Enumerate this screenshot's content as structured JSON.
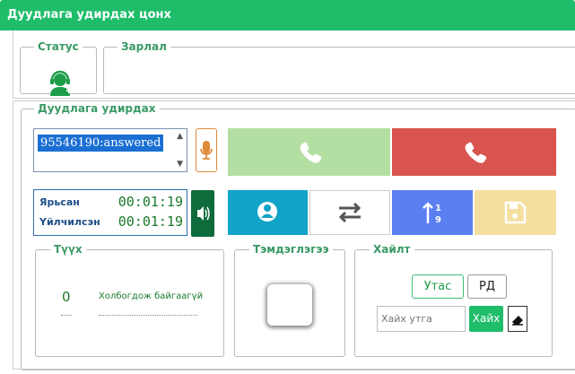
{
  "header": {
    "title": "Дуудлага удирдах цонх"
  },
  "status_section": {
    "legend": "Статус",
    "icon": "agent-headset-icon"
  },
  "announcement_section": {
    "legend": "Зарлал",
    "text": ""
  },
  "call_control": {
    "legend": "Дуудлага удирдах",
    "calls": [
      "95546190:answered"
    ],
    "selected_call": "95546190:answered",
    "answer_icon": "phone-icon",
    "hangup_icon": "phone-icon",
    "mic_icon": "microphone-icon",
    "volume_icon": "volume-icon",
    "timers": {
      "talked_label": "Ярьсан",
      "talked_value": "00:01:19",
      "served_label": "Үйлчилсэн",
      "served_value": "00:01:19"
    },
    "tool_icons": [
      "user-circle-icon",
      "transfer-arrows-icon",
      "sort-numeric-icon",
      "save-icon"
    ]
  },
  "history_section": {
    "legend": "Түүх",
    "count": "0",
    "status_text": "Холбогдож байгаагүй"
  },
  "note_section": {
    "legend": "Тэмдэглэгээ"
  },
  "search_section": {
    "legend": "Хайлт",
    "tab_phone": "Утас",
    "tab_rd": "РД",
    "search_placeholder": "Хайх утга",
    "search_button": "Хайх",
    "clear_icon": "eraser-icon"
  },
  "colors": {
    "brand_green": "#1fbd6a",
    "answer_green": "#b4dfa3",
    "hangup_red": "#d9534f",
    "tool_teal": "#11a4c8",
    "tool_blue": "#5b7ef0",
    "tool_yellow": "#f5dfa0"
  }
}
